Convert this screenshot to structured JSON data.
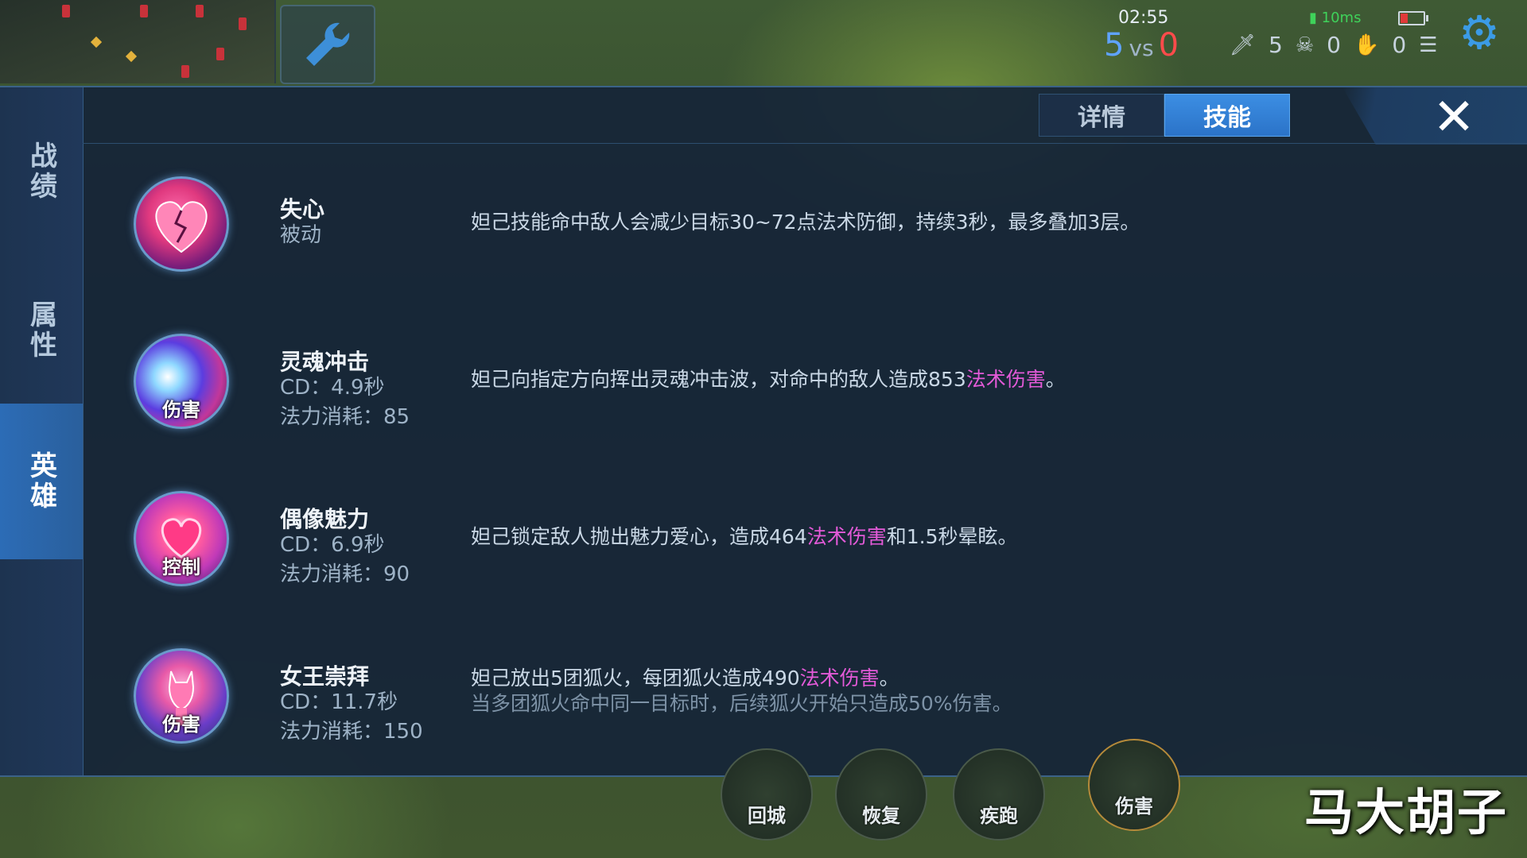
{
  "hud": {
    "time": "02:55",
    "score_left": "5",
    "score_vs": "vs",
    "score_right": "0",
    "ping": "10ms",
    "kills": "5",
    "deaths": "0",
    "assists": "0"
  },
  "sidebar": {
    "items": [
      {
        "label": "战绩",
        "active": false
      },
      {
        "label": "属性",
        "active": false
      },
      {
        "label": "英雄",
        "active": true
      }
    ]
  },
  "tabs": [
    {
      "label": "详情",
      "active": false
    },
    {
      "label": "技能",
      "active": true
    }
  ],
  "close_label": "✕",
  "skills": [
    {
      "name": "失心",
      "type": "被动",
      "tag": "",
      "desc_plain": "妲己技能命中敌人会减少目标30~72点法术防御，持续3秒，最多叠加3层。"
    },
    {
      "name": "灵魂冲击",
      "cd": "CD：4.9秒",
      "cost": "法力消耗：85",
      "tag": "伤害",
      "desc_before": "妲己向指定方向挥出灵魂冲击波，对命中的敌人造成853",
      "desc_magic": "法术伤害",
      "desc_after": "。"
    },
    {
      "name": "偶像魅力",
      "cd": "CD：6.9秒",
      "cost": "法力消耗：90",
      "tag": "控制",
      "desc_before": "妲己锁定敌人抛出魅力爱心，造成464",
      "desc_magic": "法术伤害",
      "desc_after": "和1.5秒晕眩。"
    },
    {
      "name": "女王崇拜",
      "cd": "CD：11.7秒",
      "cost": "法力消耗：150",
      "tag": "伤害",
      "desc_before": "妲己放出5团狐火，每团狐火造成490",
      "desc_magic": "法术伤害",
      "desc_after": "。",
      "desc_note": "当多团狐火命中同一目标时，后续狐火开始只造成50%伤害。"
    }
  ],
  "bottom_buttons": [
    "回城",
    "恢复",
    "疾跑",
    "伤害"
  ],
  "watermark": "马大胡子",
  "colors": {
    "accent_blue": "#2b73c8",
    "magic_damage": "#e35ad8",
    "panel_bg": "#152538"
  }
}
